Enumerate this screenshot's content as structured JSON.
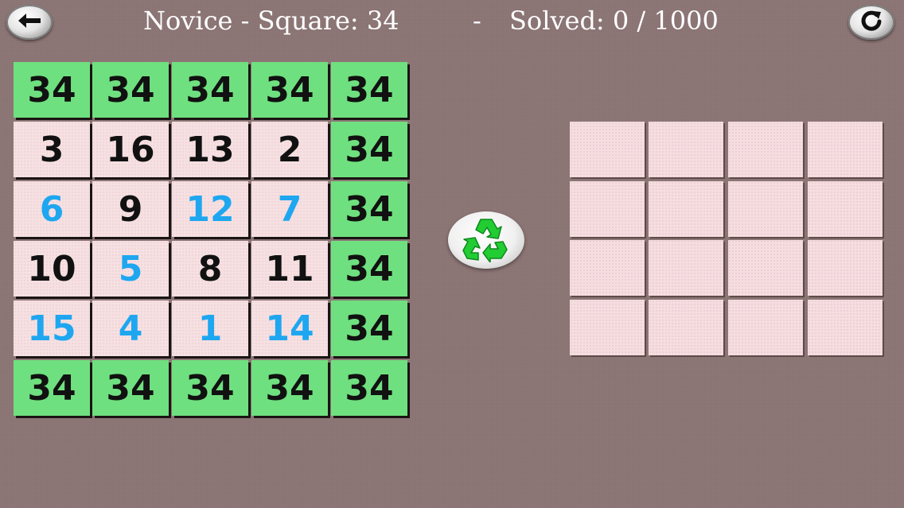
{
  "header": {
    "title": "Novice - Square: 34",
    "separator": "-",
    "solved": "Solved: 0 / 1000"
  },
  "icons": {
    "back": "left-arrow-icon",
    "restart": "refresh-icon",
    "shuffle": "recycle-icon"
  },
  "colors": {
    "sum_tile": "#6fe07f",
    "number_tile": "#f6e0e2",
    "fixed_digit": "#111111",
    "placed_digit": "#1ea7f0",
    "background": "#8a7373"
  },
  "board": {
    "top_sums": [
      "34",
      "34",
      "34",
      "34",
      "34"
    ],
    "rows": [
      {
        "cells": [
          {
            "v": "3",
            "t": "fixed"
          },
          {
            "v": "16",
            "t": "fixed"
          },
          {
            "v": "13",
            "t": "fixed"
          },
          {
            "v": "2",
            "t": "fixed"
          }
        ],
        "sum": "34"
      },
      {
        "cells": [
          {
            "v": "6",
            "t": "placed"
          },
          {
            "v": "9",
            "t": "fixed"
          },
          {
            "v": "12",
            "t": "placed"
          },
          {
            "v": "7",
            "t": "placed"
          }
        ],
        "sum": "34"
      },
      {
        "cells": [
          {
            "v": "10",
            "t": "fixed"
          },
          {
            "v": "5",
            "t": "placed"
          },
          {
            "v": "8",
            "t": "fixed"
          },
          {
            "v": "11",
            "t": "fixed"
          }
        ],
        "sum": "34"
      },
      {
        "cells": [
          {
            "v": "15",
            "t": "placed"
          },
          {
            "v": "4",
            "t": "placed"
          },
          {
            "v": "1",
            "t": "placed"
          },
          {
            "v": "14",
            "t": "placed"
          }
        ],
        "sum": "34"
      }
    ],
    "bottom_sums": [
      "34",
      "34",
      "34",
      "34",
      "34"
    ]
  },
  "tray": {
    "rows": 4,
    "cols": 4,
    "items": [
      "",
      "",
      "",
      "",
      "",
      "",
      "",
      "",
      "",
      "",
      "",
      "",
      "",
      "",
      "",
      ""
    ]
  }
}
